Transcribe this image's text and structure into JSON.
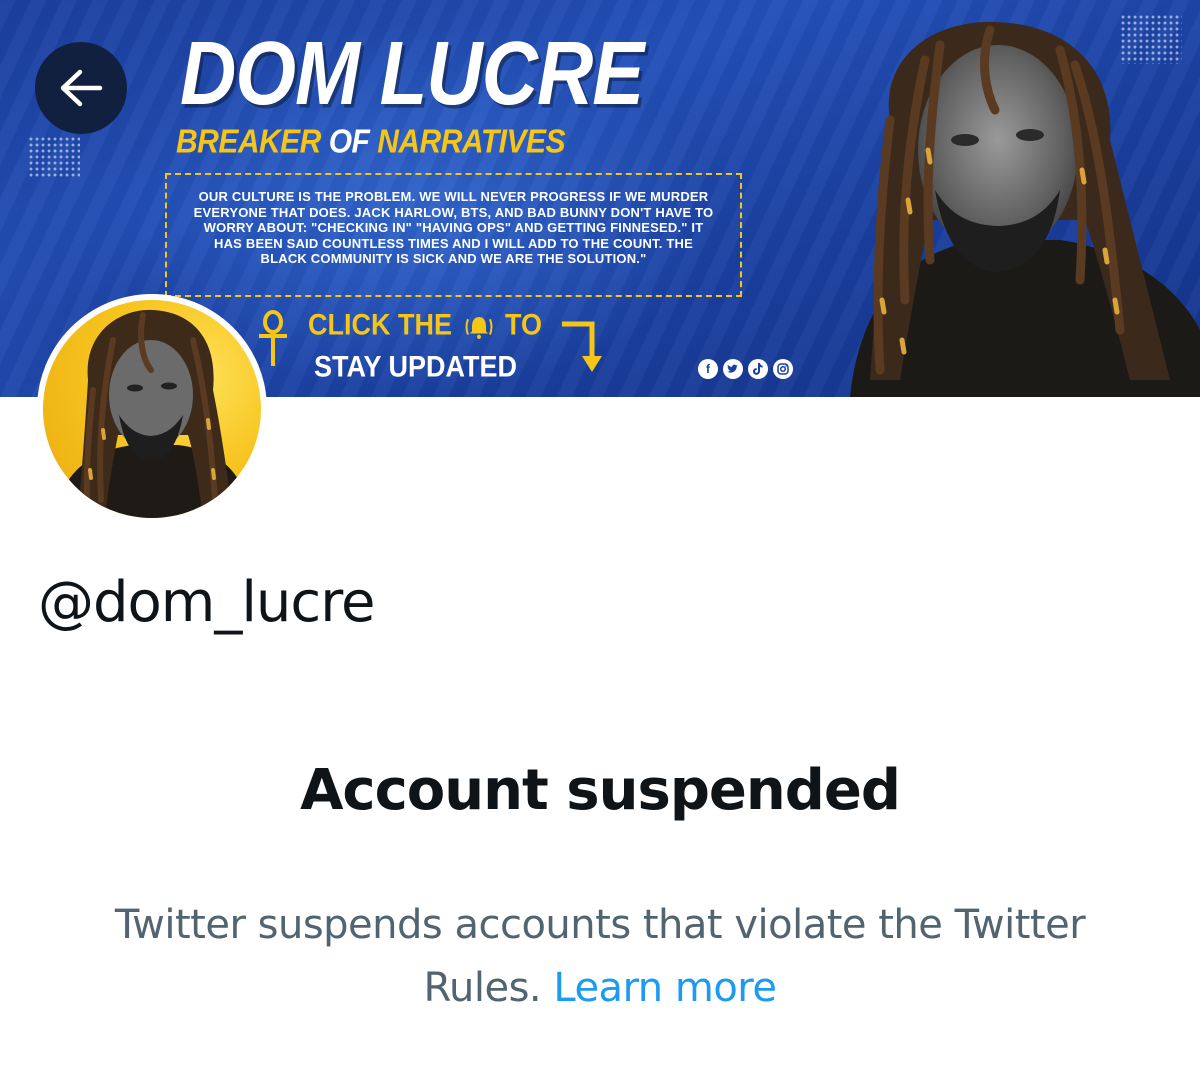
{
  "banner": {
    "title": "DOM LUCRE",
    "subtitle_part1": "BREAKER",
    "subtitle_part2": "OF",
    "subtitle_part3": "NARRATIVES",
    "quote_lines": [
      "OUR CULTURE IS THE PROBLEM. WE WILL NEVER PROGRESS IF WE MURDER",
      "EVERYONE THAT DOES. JACK HARLOW, BTS, AND BAD BUNNY DON'T HAVE TO",
      "WORRY ABOUT: \"CHECKING IN\" \"HAVING OPS\" AND GETTING FINNESED.\" IT",
      "HAS BEEN SAID COUNTLESS TIMES AND I WILL ADD TO THE COUNT. THE",
      "BLACK COMMUNITY IS SICK AND WE ARE THE SOLUTION.\""
    ],
    "cta_line1_a": "CLICK THE",
    "cta_line1_b": "TO",
    "cta_line2": "STAY UPDATED",
    "social_icons": [
      "facebook-icon",
      "twitter-icon",
      "tiktok-icon",
      "instagram-icon"
    ],
    "colors": {
      "accent_yellow": "#f5c518",
      "banner_blue": "#1f48ad"
    }
  },
  "profile": {
    "handle": "@dom_lucre"
  },
  "suspension": {
    "title": "Account suspended",
    "message": "Twitter suspends accounts that violate the Twitter Rules.",
    "link_label": "Learn more",
    "colors": {
      "title": "#0f1419",
      "message": "#536471",
      "link": "#1d9bf0"
    }
  }
}
